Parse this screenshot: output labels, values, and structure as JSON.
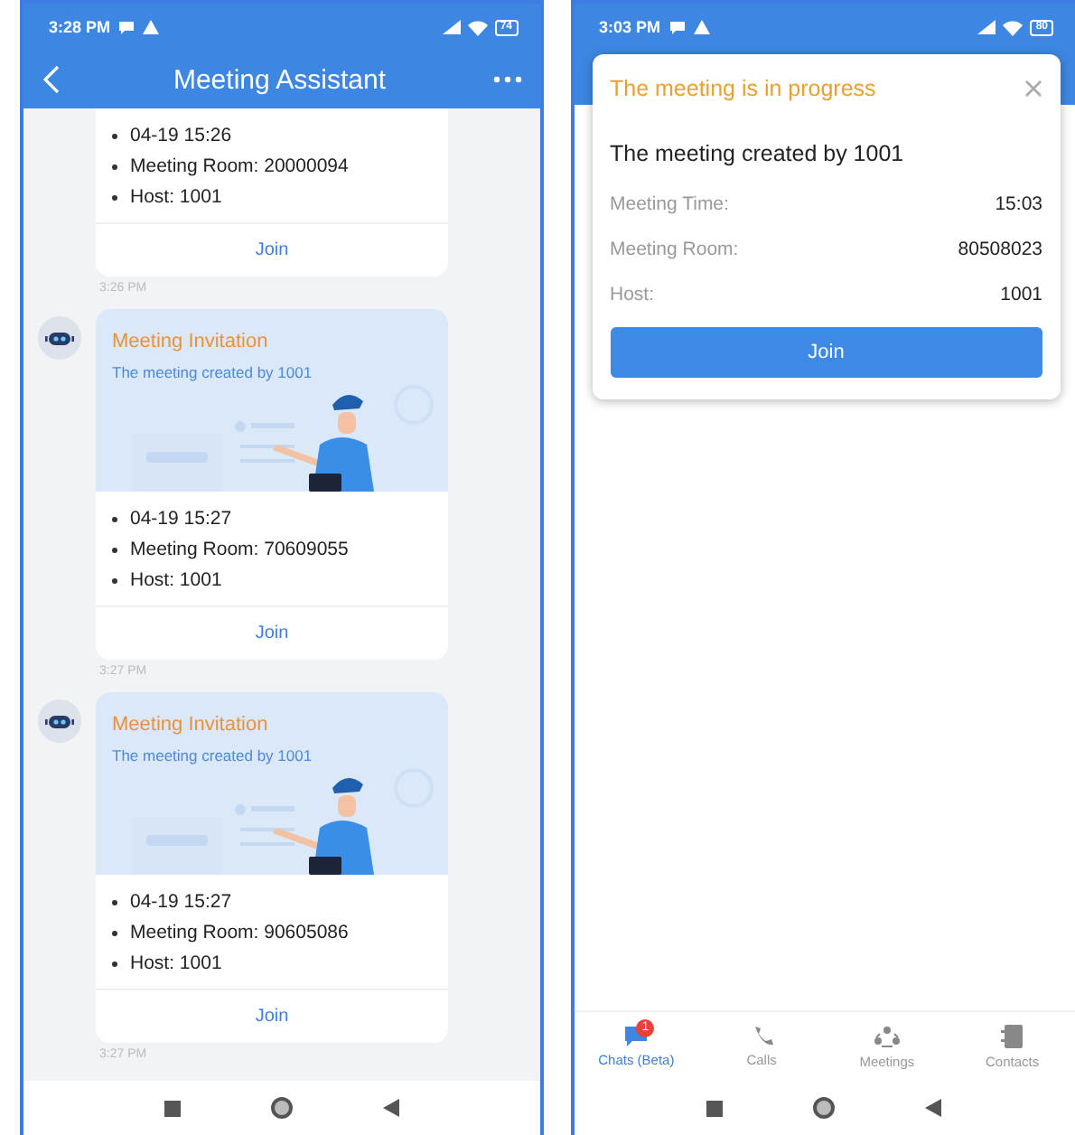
{
  "left_phone": {
    "status_bar": {
      "time": "3:28 PM",
      "battery": "74"
    },
    "header": {
      "title": "Meeting Assistant"
    },
    "chat": [
      {
        "kind": "card",
        "details": [
          "04-19 15:26",
          "Meeting Room: 20000094",
          "Host: 1001"
        ],
        "button": "Join"
      },
      {
        "kind": "time",
        "text": "3:26 PM"
      },
      {
        "kind": "card",
        "banner": {
          "title": "Meeting Invitation",
          "subtitle": "The meeting created by 1001"
        },
        "details": [
          "04-19 15:27",
          "Meeting Room: 70609055",
          "Host: 1001"
        ],
        "button": "Join"
      },
      {
        "kind": "time",
        "text": "3:27 PM"
      },
      {
        "kind": "card",
        "banner": {
          "title": "Meeting Invitation",
          "subtitle": "The meeting created by 1001"
        },
        "details": [
          "04-19 15:27",
          "Meeting Room: 90605086",
          "Host: 1001"
        ],
        "button": "Join"
      },
      {
        "kind": "time",
        "text": "3:27 PM"
      }
    ]
  },
  "right_phone": {
    "status_bar": {
      "time": "3:03 PM",
      "battery": "80"
    },
    "dialog": {
      "title": "The meeting is in progress",
      "heading": "The meeting created by 1001",
      "rows": [
        {
          "label": "Meeting Time:",
          "value": "15:03"
        },
        {
          "label": "Meeting Room:",
          "value": "80508023"
        },
        {
          "label": "Host:",
          "value": "1001"
        }
      ],
      "button": "Join"
    },
    "tabs": [
      {
        "label": "Chats (Beta)",
        "selected": true,
        "badge": "1"
      },
      {
        "label": "Calls",
        "selected": false
      },
      {
        "label": "Meetings",
        "selected": false
      },
      {
        "label": "Contacts",
        "selected": false
      }
    ]
  }
}
